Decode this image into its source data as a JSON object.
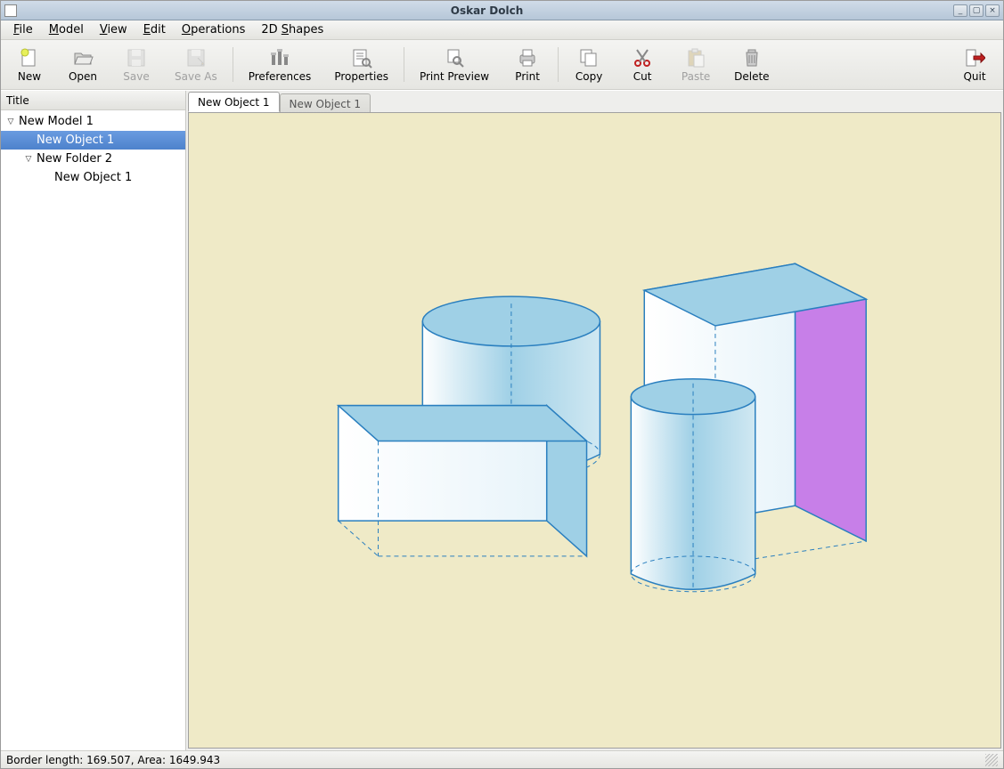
{
  "window": {
    "title": "Oskar Dolch"
  },
  "menubar": {
    "file": "File",
    "file_ul": "F",
    "model": "Model",
    "model_ul": "M",
    "view": "View",
    "view_ul": "V",
    "edit": "Edit",
    "edit_ul": "E",
    "operations": "Operations",
    "operations_ul": "O",
    "shapes2d": "2D Shapes",
    "shapes2d_ul": "S"
  },
  "toolbar": {
    "new": "New",
    "open": "Open",
    "save": "Save",
    "save_as": "Save As",
    "preferences": "Preferences",
    "properties": "Properties",
    "print_preview": "Print Preview",
    "print": "Print",
    "copy": "Copy",
    "cut": "Cut",
    "paste": "Paste",
    "delete": "Delete",
    "quit": "Quit"
  },
  "sidebar": {
    "header": "Title",
    "items": [
      {
        "label": "New Model 1",
        "indent": 0,
        "expander": true,
        "selected": false
      },
      {
        "label": "New Object 1",
        "indent": 1,
        "expander": false,
        "selected": true
      },
      {
        "label": "New Folder 2",
        "indent": 1,
        "expander": true,
        "selected": false
      },
      {
        "label": "New Object 1",
        "indent": 2,
        "expander": false,
        "selected": false
      }
    ]
  },
  "tabs": [
    {
      "label": "New Object 1",
      "active": true
    },
    {
      "label": "New Object 1",
      "active": false
    }
  ],
  "status": {
    "text": "Border length: 169.507, Area: 1649.943",
    "border_length": 169.507,
    "area": 1649.943
  },
  "colors": {
    "canvas_bg": "#efeac7",
    "shape_blue_fill": "#9fd0e6",
    "shape_stroke": "#2a7fbf",
    "shape_purple": "#c77fe8",
    "selection": "#5b8fd4"
  }
}
